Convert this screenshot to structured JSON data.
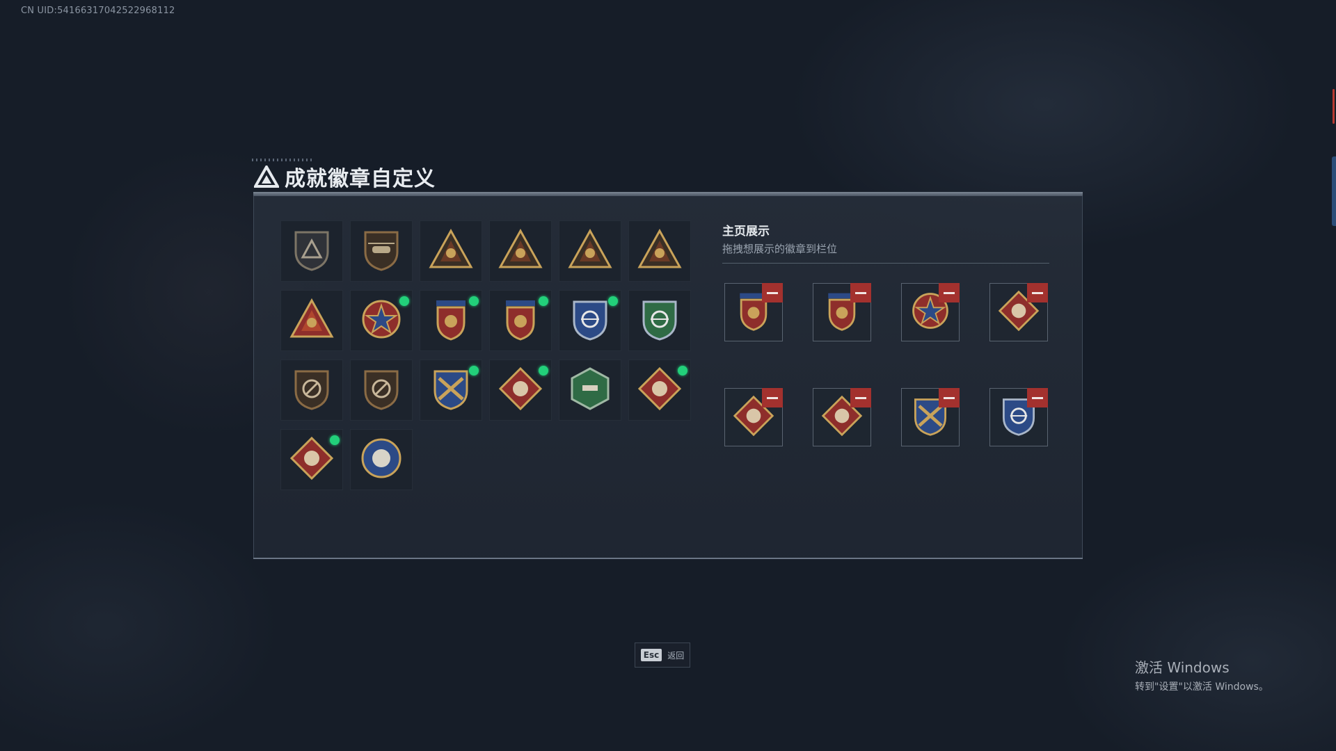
{
  "uid_text": "CN UID:541663170425229681​12",
  "title": "成就徽章自定义",
  "showcase": {
    "title": "主页展示",
    "subtitle": "拖拽想展示的徽章到栏位"
  },
  "badges": [
    {
      "icon": "delta-shield-badge-icon",
      "new": false
    },
    {
      "icon": "helicopter-shield-badge-icon",
      "new": false
    },
    {
      "icon": "skull-triangle-badge-icon",
      "new": false
    },
    {
      "icon": "level-54-badge-icon",
      "new": false
    },
    {
      "icon": "level-55-badge-icon",
      "new": false
    },
    {
      "icon": "level-56-badge-icon",
      "new": false
    },
    {
      "icon": "rank-1-triangle-badge-icon",
      "new": false
    },
    {
      "icon": "star-medal-badge-icon",
      "new": true
    },
    {
      "icon": "red-crest-badge-icon",
      "new": true
    },
    {
      "icon": "red-crest-star-badge-icon",
      "new": true
    },
    {
      "icon": "blue-crosshair-shield-badge-icon",
      "new": true
    },
    {
      "icon": "green-crosshair-shield-badge-icon",
      "new": false
    },
    {
      "icon": "no-gun-shield-badge-icon",
      "new": false
    },
    {
      "icon": "no-gun-shield-alt-badge-icon",
      "new": false
    },
    {
      "icon": "gold-crossed-guns-badge-icon",
      "new": true
    },
    {
      "icon": "wolf-diamond-badge-icon",
      "new": true
    },
    {
      "icon": "green-hex-gun-badge-icon",
      "new": false
    },
    {
      "icon": "dragon-diamond-badge-icon",
      "new": true
    },
    {
      "icon": "runner-diamond-badge-icon",
      "new": true
    },
    {
      "icon": "wolf-round-badge-icon",
      "new": false
    }
  ],
  "showcase_slots": [
    {
      "icon": "red-crest-star-badge-icon"
    },
    {
      "icon": "red-crest-badge-icon"
    },
    {
      "icon": "star-medal-badge-icon"
    },
    {
      "icon": "dragon-diamond-badge-icon"
    },
    {
      "icon": "wolf-diamond-badge-icon"
    },
    {
      "icon": "runner-diamond-badge-icon"
    },
    {
      "icon": "gold-crossed-guns-badge-icon"
    },
    {
      "icon": "blue-crosshair-shield-badge-icon"
    }
  ],
  "esc": {
    "key": "Esc",
    "label": "返回"
  },
  "windows_watermark": {
    "line1": "激活 Windows",
    "line2": "转到\"设置\"以激活 Windows。"
  },
  "colors": {
    "accent_red": "#a3312e",
    "new_dot": "#22d07a",
    "gold": "#c9a35a",
    "bronze": "#8a6b45"
  }
}
